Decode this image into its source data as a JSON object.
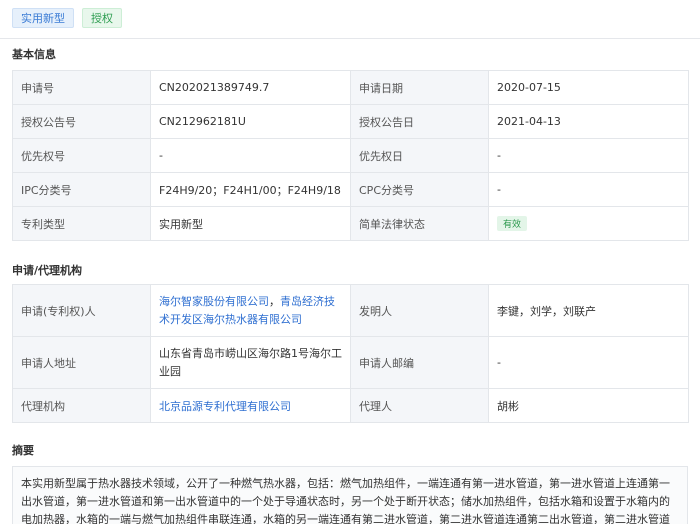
{
  "tags": {
    "type": "实用新型",
    "status": "授权"
  },
  "basic": {
    "title": "基本信息",
    "rows": [
      {
        "l1": "申请号",
        "v1": "CN202021389749.7",
        "l2": "申请日期",
        "v2": "2020-07-15"
      },
      {
        "l1": "授权公告号",
        "v1": "CN212962181U",
        "l2": "授权公告日",
        "v2": "2021-04-13"
      },
      {
        "l1": "优先权号",
        "v1": "-",
        "l2": "优先权日",
        "v2": "-"
      },
      {
        "l1": "IPC分类号",
        "v1": "F24H9/20；F24H1/00；F24H9/18",
        "l2": "CPC分类号",
        "v2": "-"
      },
      {
        "l1": "专利类型",
        "v1": "实用新型",
        "l2": "简单法律状态",
        "v2": "有效"
      }
    ]
  },
  "agency": {
    "title": "申请/代理机构",
    "applicant_label": "申请(专利权)人",
    "applicant_1": "海尔智家股份有限公司",
    "applicant_sep": "，",
    "applicant_2": "青岛经济技术开发区海尔热水器有限公司",
    "inventor_label": "发明人",
    "inventor_value": "李键，刘学，刘联产",
    "address_label": "申请人地址",
    "address_value": "山东省青岛市崂山区海尔路1号海尔工业园",
    "postcode_label": "申请人邮编",
    "postcode_value": "-",
    "agency_label": "代理机构",
    "agency_value": "北京品源专利代理有限公司",
    "agent_label": "代理人",
    "agent_value": "胡彬"
  },
  "abstract": {
    "title": "摘要",
    "text": "本实用新型属于热水器技术领域，公开了一种燃气热水器，包括：燃气加热组件，一端连通有第一进水管道，第一进水管道上连通第一出水管道，第一进水管道和第一出水管道中的一个处于导通状态时，另一个处于断开状态；储水加热组件，包括水箱和设置于水箱内的电加热器，水箱的一端与燃气加热组件串联连通，水箱的另一端连通有第二进水管道，第二进水管道连通第二出水管道，第二进水管道和第二"
  }
}
